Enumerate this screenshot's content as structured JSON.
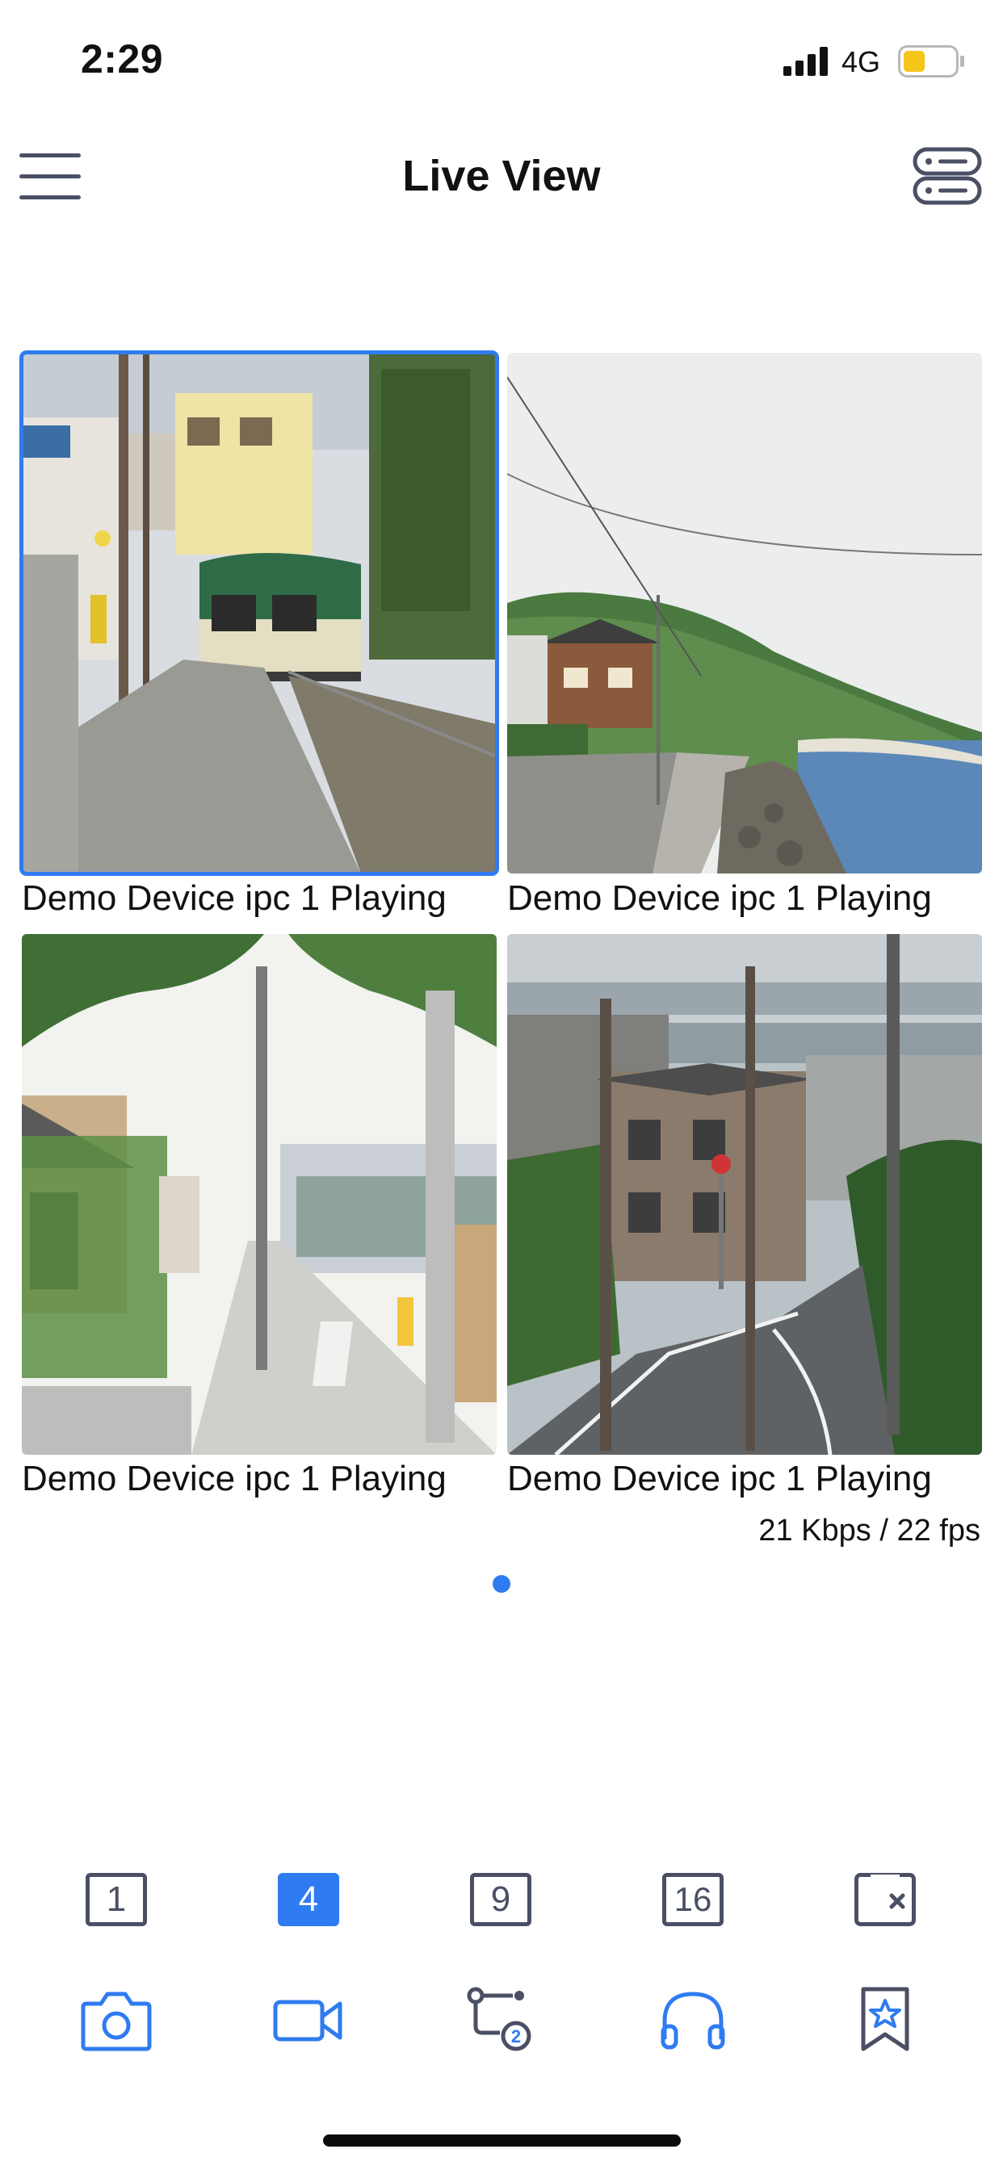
{
  "status_bar": {
    "time": "2:29",
    "network": "4G",
    "battery_color": "#f5c518"
  },
  "header": {
    "title": "Live View",
    "menu_icon": "hamburger-menu-icon",
    "right_icon": "server-list-icon"
  },
  "grid": {
    "tiles": [
      {
        "label": "Demo Device ipc 1 Playing",
        "selected": true,
        "scene": "train-crossing"
      },
      {
        "label": "Demo Device ipc 1 Playing",
        "selected": false,
        "scene": "coastal-road"
      },
      {
        "label": "Demo Device ipc 1 Playing",
        "selected": false,
        "scene": "residential-street"
      },
      {
        "label": "Demo Device ipc 1 Playing",
        "selected": false,
        "scene": "hillside-intersection"
      }
    ],
    "stats": "21 Kbps / 22 fps"
  },
  "pagination": {
    "current_page": 1,
    "page_count": 1
  },
  "layout_switcher": {
    "options": [
      "1",
      "4",
      "9",
      "16"
    ],
    "selected": "4",
    "close_icon": "close-layout-icon"
  },
  "toolbar": {
    "actions": [
      {
        "icon": "camera-snapshot-icon"
      },
      {
        "icon": "video-record-icon"
      },
      {
        "icon": "playback-timeline-icon",
        "badge": "2"
      },
      {
        "icon": "headphones-audio-icon",
        "active": true
      },
      {
        "icon": "bookmark-star-icon"
      }
    ]
  },
  "colors": {
    "accent": "#2f7bf1",
    "icon_gray": "#4a4f64",
    "text": "#111111"
  }
}
